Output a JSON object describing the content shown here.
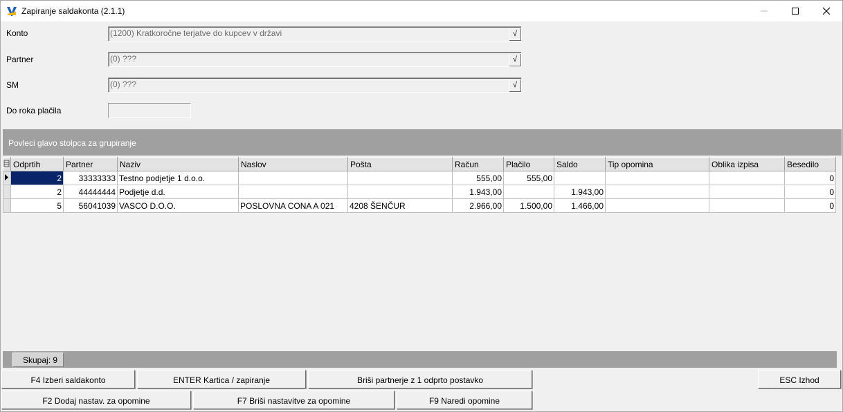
{
  "window": {
    "title": "Zapiranje saldakonta  (2.1.1)"
  },
  "filters": {
    "konto": {
      "label": "Konto",
      "value": "(1200) Kratkoročne terjatve do kupcev v državi"
    },
    "partner": {
      "label": "Partner",
      "value": "(0) ???"
    },
    "sm": {
      "label": "SM",
      "value": "(0) ???"
    },
    "do_roka": {
      "label": "Do roka plačila",
      "value": ""
    },
    "dropdown_glyph": "√"
  },
  "group_panel": {
    "text": "Povleci glavo stolpca za grupiranje"
  },
  "grid": {
    "columns": [
      "Odprtih",
      "Partner",
      "Naziv",
      "Naslov",
      "Pošta",
      "Račun",
      "Plačilo",
      "Saldo",
      "Tip opomina",
      "Oblika izpisa",
      "Besedilo"
    ],
    "rows": [
      {
        "odprtih": "2",
        "partner": "33333333",
        "naziv": "Testno podjetje 1 d.o.o.",
        "naslov": "",
        "posta": "",
        "racun": "555,00",
        "placilo": "555,00",
        "saldo": "",
        "tip": "",
        "oblika": "",
        "besedilo": "0"
      },
      {
        "odprtih": "2",
        "partner": "44444444",
        "naziv": "Podjetje d.d.",
        "naslov": "",
        "posta": "",
        "racun": "1.943,00",
        "placilo": "",
        "saldo": "1.943,00",
        "tip": "",
        "oblika": "",
        "besedilo": "0"
      },
      {
        "odprtih": "5",
        "partner": "56041039",
        "naziv": "VASCO D.O.O.",
        "naslov": "POSLOVNA CONA A 021",
        "posta": "4208 ŠENČUR",
        "racun": "2.966,00",
        "placilo": "1.500,00",
        "saldo": "1.466,00",
        "tip": "",
        "oblika": "",
        "besedilo": "0"
      }
    ],
    "footer": {
      "total": "Skupaj: 9"
    }
  },
  "buttons": {
    "f4": "F4 Izberi saldakonto",
    "enter": "ENTER Kartica / zapiranje",
    "brisi": "Briši partnerje z 1 odprto postavko",
    "esc": "ESC Izhod",
    "f2": "F2 Dodaj nastav. za opomine",
    "f7": "F7 Briši nastavitve za opomine",
    "f9": "F9 Naredi opomine"
  }
}
